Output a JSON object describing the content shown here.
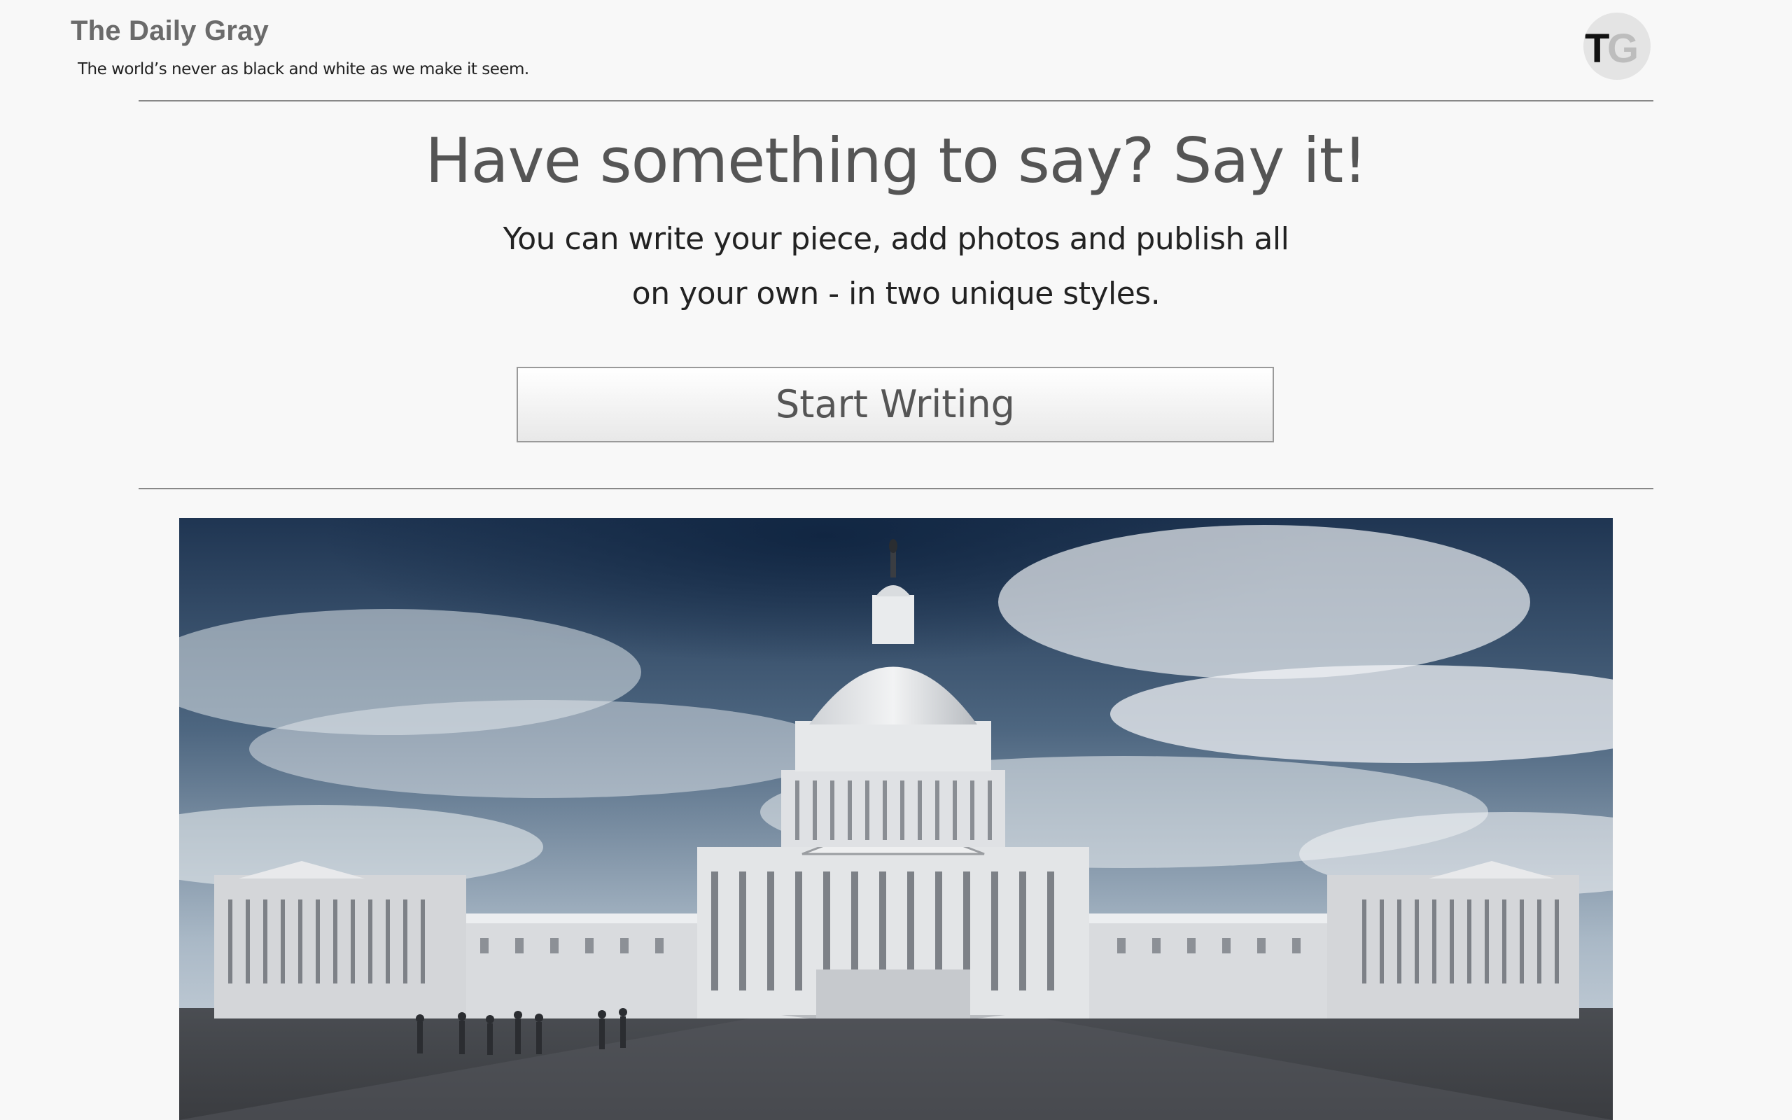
{
  "header": {
    "brand": "The Daily Gray",
    "tagline": "The world’s never as black and white as we make it seem.",
    "avatar": {
      "letter1": "T",
      "letter2": "G"
    }
  },
  "hero": {
    "title": "Have something to say? Say it!",
    "subtitle_line1": "You can write your piece, add photos and publish all",
    "subtitle_line2": "on your own - in two unique styles.",
    "cta_label": "Start Writing"
  },
  "feature_image": {
    "subject": "us-capitol-building-photo"
  },
  "colors": {
    "background": "#f8f8f8",
    "brand_text": "#6b6b6b",
    "rule": "#888888"
  }
}
